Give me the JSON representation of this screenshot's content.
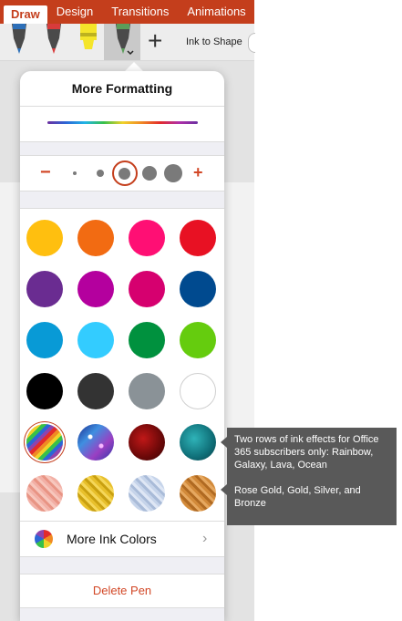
{
  "ribbon": {
    "tabs": [
      {
        "label": "Draw",
        "active": true
      },
      {
        "label": "Design",
        "active": false
      },
      {
        "label": "Transitions",
        "active": false
      },
      {
        "label": "Animations",
        "active": false
      }
    ],
    "accent": "#c43e1c"
  },
  "toolbar": {
    "pens": [
      {
        "icon": "pen-blue-icon",
        "tip_color": "#2d6fb8"
      },
      {
        "icon": "pen-red-icon",
        "tip_color": "#d83b3b"
      },
      {
        "icon": "highlighter-yellow-icon",
        "tip_color": "#f5e52a"
      },
      {
        "icon": "pen-rainbow-icon",
        "tip_color": "#5a9d5a"
      }
    ],
    "add_icon": "plus-icon",
    "ink_to_shape_label": "Ink to Shape"
  },
  "popover": {
    "title": "More Formatting",
    "size_minus": "−",
    "size_plus": "+",
    "size_levels": 5,
    "selected_size_index": 2,
    "swatches": [
      [
        "#ffbf0f",
        "#f26b12",
        "#ff0f74",
        "#e81123"
      ],
      [
        "#6a2c91",
        "#b4009e",
        "#d6006f",
        "#004a8f"
      ],
      [
        "#089ad6",
        "#33ccff",
        "#00913e",
        "#65cc0e"
      ],
      [
        "#000000",
        "#333333",
        "#8a9297",
        "#ffffff"
      ]
    ],
    "effects": [
      [
        "rainbow",
        "galaxy",
        "lava",
        "ocean"
      ],
      [
        "rose-gold",
        "gold",
        "silver",
        "bronze"
      ]
    ],
    "selected_swatch": "rainbow",
    "more_ink_colors_label": "More Ink Colors",
    "more_ink_colors_chevron": "›",
    "delete_pen_label": "Delete Pen"
  },
  "callout": {
    "text1": "Two rows of ink effects for Office 365 subscribers only: Rainbow, Galaxy, Lava, Ocean",
    "text2": "Rose Gold, Gold, Silver, and Bronze"
  }
}
